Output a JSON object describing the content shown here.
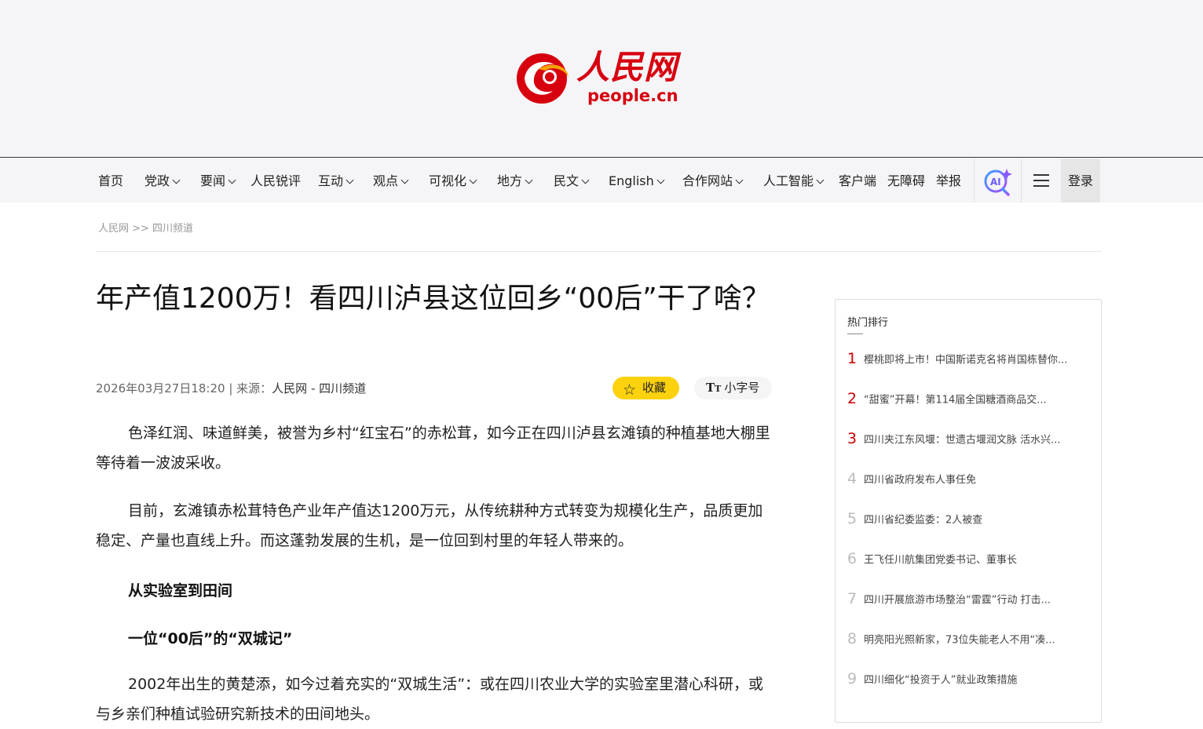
{
  "logo": {
    "cn": "人民网",
    "en": "people.cn"
  },
  "nav": {
    "items": [
      {
        "label": "首页",
        "dropdown": false
      },
      {
        "label": "党政",
        "dropdown": true
      },
      {
        "label": "要闻",
        "dropdown": true
      },
      {
        "label": "人民锐评",
        "dropdown": false
      },
      {
        "label": "互动",
        "dropdown": true
      },
      {
        "label": "观点",
        "dropdown": true
      },
      {
        "label": "可视化",
        "dropdown": true
      },
      {
        "label": "地方",
        "dropdown": true
      },
      {
        "label": "民文",
        "dropdown": true
      },
      {
        "label": "English",
        "dropdown": true
      },
      {
        "label": "合作网站",
        "dropdown": true
      },
      {
        "label": "人工智能",
        "dropdown": true
      },
      {
        "label": "客户端",
        "dropdown": false
      },
      {
        "label": "无障碍",
        "dropdown": false
      },
      {
        "label": "举报",
        "dropdown": false
      }
    ],
    "login": "登录"
  },
  "breadcrumb": "人民网 >> 四川频道",
  "article": {
    "title": "年产值1200万！看四川泸县这位回乡“00后”干了啥？",
    "date": "2026年03月27日18:20",
    "source_label": " | 来源：",
    "source": "人民网 - 四川频道",
    "favorite_label": "收藏",
    "font_size_label": "小字号",
    "paragraphs": [
      "色泽红润、味道鲜美，被誉为乡村“红宝石”的赤松茸，如今正在四川泸县玄滩镇的种植基地大棚里等待着一波波采收。",
      "目前，玄滩镇赤松茸特色产业年产值达1200万元，从传统耕种方式转变为规模化生产，品质更加稳定、产量也直线上升。而这蓬勃发展的生机，是一位回到村里的年轻人带来的。"
    ],
    "subheads": [
      "从实验室到田间",
      "一位“00后”的“双城记”"
    ],
    "paragraph3": "2002年出生的黄楚添，如今过着充实的“双城生活”：或在四川农业大学的实验室里潜心科研，或与乡亲们种植试验研究新技术的田间地头。"
  },
  "hot": {
    "title": "热门排行",
    "items": [
      "樱桃即将上市！中国斯诺克名将肖国栋替你...",
      "“甜蜜”开幕！第114届全国糖酒商品交...",
      "四川夹江东风堰：世遗古堰润文脉 活水兴...",
      "四川省政府发布人事任免",
      "四川省纪委监委：2人被查",
      "王飞任川航集团党委书记、董事长",
      "四川开展旅游市场整治“雷霆”行动 打击...",
      "明亮阳光照新家，73位失能老人不用“凑...",
      "四川细化“投资于人”就业政策措施"
    ]
  },
  "colors": {
    "brand": "#d7000f",
    "favorite": "#fcd20f",
    "rank_top": "#cc0000"
  }
}
